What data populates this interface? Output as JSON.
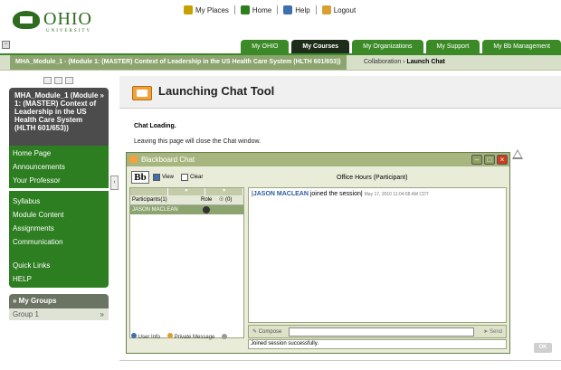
{
  "logo": {
    "word": "OHIO",
    "sub": "UNIVERSITY"
  },
  "toplinks": [
    {
      "label": "My Places",
      "icon": "person-icon",
      "color": "#c8a000"
    },
    {
      "label": "Home",
      "icon": "home-icon",
      "color": "#2d7d21"
    },
    {
      "label": "Help",
      "icon": "help-icon",
      "color": "#3f6fb0"
    },
    {
      "label": "Logout",
      "icon": "logout-icon",
      "color": "#d8a030"
    }
  ],
  "tabs": [
    {
      "label": "My OHIO",
      "active": false
    },
    {
      "label": "My Courses",
      "active": true
    },
    {
      "label": "My Organizations",
      "active": false
    },
    {
      "label": "My Support",
      "active": false
    },
    {
      "label": "My Bb Management",
      "active": false
    }
  ],
  "breadcrumb": {
    "course": "MHA_Module_1 - (Module 1: (MASTER) Context of Leadership in the US Health Care System (HLTH 601/653))",
    "trail": "Collaboration",
    "current": "Launch Chat"
  },
  "sidebar": {
    "course_title": "MHA_Module_1 (Module 1: (MASTER) Context of Leadership in the US Health Care System (HLTH 601/653))",
    "group1": [
      "Home Page",
      "Announcements",
      "Your Professor"
    ],
    "group2": [
      "Syllabus",
      "Module Content",
      "Assignments",
      "Communication"
    ],
    "group3": [
      "Quick Links",
      "HELP"
    ],
    "groups_header": "My Groups",
    "groups": [
      "Group 1"
    ]
  },
  "page": {
    "title": "Launching Chat Tool",
    "loading": "Chat Loading.",
    "warning": "Leaving this page will close the Chat window."
  },
  "chat": {
    "window_title": "Blackboard Chat",
    "bb_logo": "Bb",
    "view_label": "View",
    "clear_label": "Clear",
    "room_title": "Office Hours (Participant)",
    "participants_header": "Participants(1)",
    "role_header": "Role",
    "count_header": "(0)",
    "participants": [
      {
        "name": "JASON MACLEAN"
      }
    ],
    "message_user": "JASON MACLEAN",
    "message_text": " joined the session",
    "message_time": "May 17, 2010 11:04:58 AM CDT",
    "compose_label": "Compose",
    "send_label": "Send",
    "status": "Joined session successfully.",
    "user_info_label": "User Info",
    "private_message_label": "Private Message"
  },
  "ok_label": "OK",
  "colors": {
    "accent": "#3c8a27",
    "nav_dark": "#1e2d1a",
    "chat_bar": "#a7b67e"
  }
}
